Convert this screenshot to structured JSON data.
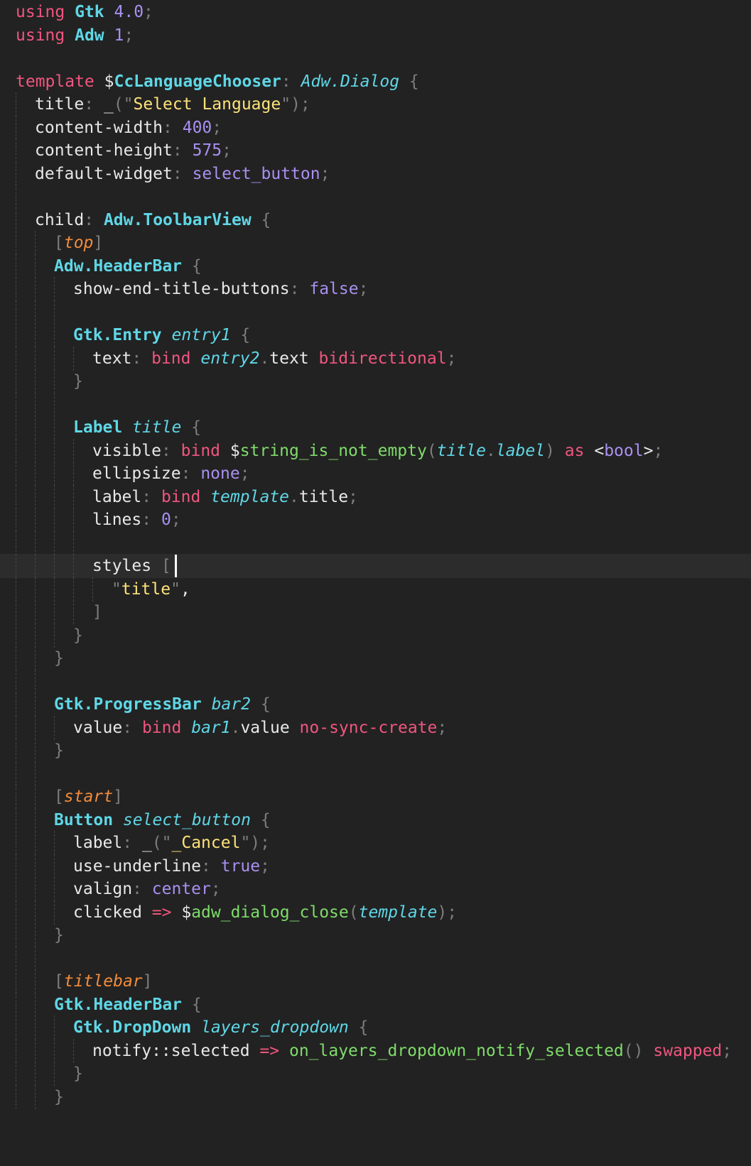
{
  "editor": {
    "language": "blueprint",
    "current_line": 24,
    "lines": [
      {
        "indent": 0,
        "tokens": [
          [
            "k",
            "using"
          ],
          [
            "w",
            " "
          ],
          [
            "ty",
            "Gtk"
          ],
          [
            "n",
            " 4.0"
          ],
          [
            "p",
            ";"
          ]
        ]
      },
      {
        "indent": 0,
        "tokens": [
          [
            "k",
            "using"
          ],
          [
            "w",
            " "
          ],
          [
            "ty",
            "Adw"
          ],
          [
            "n",
            " 1"
          ],
          [
            "p",
            ";"
          ]
        ]
      },
      {
        "indent": 0,
        "tokens": []
      },
      {
        "indent": 0,
        "tokens": [
          [
            "k",
            "template"
          ],
          [
            "w",
            " $"
          ],
          [
            "ty",
            "CcLanguageChooser"
          ],
          [
            "p",
            ": "
          ],
          [
            "it",
            "Adw.Dialog"
          ],
          [
            "p",
            " {"
          ]
        ]
      },
      {
        "indent": 1,
        "tokens": [
          [
            "w",
            "title"
          ],
          [
            "p",
            ": "
          ],
          [
            "w",
            "_"
          ],
          [
            "p",
            "(\""
          ],
          [
            "s",
            "Select Language"
          ],
          [
            "p",
            "\");"
          ]
        ]
      },
      {
        "indent": 1,
        "tokens": [
          [
            "w",
            "content-width"
          ],
          [
            "p",
            ": "
          ],
          [
            "n",
            "400"
          ],
          [
            "p",
            ";"
          ]
        ]
      },
      {
        "indent": 1,
        "tokens": [
          [
            "w",
            "content-height"
          ],
          [
            "p",
            ": "
          ],
          [
            "n",
            "575"
          ],
          [
            "p",
            ";"
          ]
        ]
      },
      {
        "indent": 1,
        "tokens": [
          [
            "w",
            "default-widget"
          ],
          [
            "p",
            ": "
          ],
          [
            "n",
            "select_button"
          ],
          [
            "p",
            ";"
          ]
        ]
      },
      {
        "indent": 1,
        "tokens": []
      },
      {
        "indent": 1,
        "tokens": [
          [
            "w",
            "child"
          ],
          [
            "p",
            ": "
          ],
          [
            "ty",
            "Adw.ToolbarView"
          ],
          [
            "p",
            " {"
          ]
        ]
      },
      {
        "indent": 2,
        "tokens": [
          [
            "p",
            "["
          ],
          [
            "ann",
            "top"
          ],
          [
            "p",
            "]"
          ]
        ]
      },
      {
        "indent": 2,
        "tokens": [
          [
            "ty",
            "Adw.HeaderBar"
          ],
          [
            "p",
            " {"
          ]
        ]
      },
      {
        "indent": 3,
        "tokens": [
          [
            "w",
            "show-end-title-buttons"
          ],
          [
            "p",
            ": "
          ],
          [
            "n",
            "false"
          ],
          [
            "p",
            ";"
          ]
        ]
      },
      {
        "indent": 3,
        "tokens": []
      },
      {
        "indent": 3,
        "tokens": [
          [
            "ty",
            "Gtk.Entry"
          ],
          [
            "w",
            " "
          ],
          [
            "it",
            "entry1"
          ],
          [
            "p",
            " {"
          ]
        ]
      },
      {
        "indent": 4,
        "tokens": [
          [
            "w",
            "text"
          ],
          [
            "p",
            ": "
          ],
          [
            "k",
            "bind"
          ],
          [
            "w",
            " "
          ],
          [
            "it",
            "entry2"
          ],
          [
            "p",
            "."
          ],
          [
            "w",
            "text "
          ],
          [
            "k",
            "bidirectional"
          ],
          [
            "p",
            ";"
          ]
        ]
      },
      {
        "indent": 3,
        "tokens": [
          [
            "p",
            "}"
          ]
        ]
      },
      {
        "indent": 3,
        "tokens": []
      },
      {
        "indent": 3,
        "tokens": [
          [
            "ty",
            "Label"
          ],
          [
            "w",
            " "
          ],
          [
            "it",
            "title"
          ],
          [
            "p",
            " {"
          ]
        ]
      },
      {
        "indent": 4,
        "tokens": [
          [
            "w",
            "visible"
          ],
          [
            "p",
            ": "
          ],
          [
            "k",
            "bind"
          ],
          [
            "w",
            " $"
          ],
          [
            "f",
            "string_is_not_empty"
          ],
          [
            "p",
            "("
          ],
          [
            "it",
            "title"
          ],
          [
            "p",
            "."
          ],
          [
            "it",
            "label"
          ],
          [
            "p",
            ")"
          ],
          [
            "w",
            " "
          ],
          [
            "k",
            "as"
          ],
          [
            "w",
            " <"
          ],
          [
            "n",
            "bool"
          ],
          [
            "w",
            ">"
          ],
          [
            "p",
            ";"
          ]
        ]
      },
      {
        "indent": 4,
        "tokens": [
          [
            "w",
            "ellipsize"
          ],
          [
            "p",
            ": "
          ],
          [
            "n",
            "none"
          ],
          [
            "p",
            ";"
          ]
        ]
      },
      {
        "indent": 4,
        "tokens": [
          [
            "w",
            "label"
          ],
          [
            "p",
            ": "
          ],
          [
            "k",
            "bind"
          ],
          [
            "w",
            " "
          ],
          [
            "it",
            "template"
          ],
          [
            "p",
            "."
          ],
          [
            "w",
            "title"
          ],
          [
            "p",
            ";"
          ]
        ]
      },
      {
        "indent": 4,
        "tokens": [
          [
            "w",
            "lines"
          ],
          [
            "p",
            ": "
          ],
          [
            "n",
            "0"
          ],
          [
            "p",
            ";"
          ]
        ]
      },
      {
        "indent": 4,
        "tokens": []
      },
      {
        "indent": 4,
        "tokens": [
          [
            "w",
            "styles "
          ],
          [
            "p",
            "["
          ]
        ]
      },
      {
        "indent": 5,
        "tokens": [
          [
            "p",
            "\""
          ],
          [
            "s",
            "title"
          ],
          [
            "p",
            "\""
          ],
          [
            "w",
            ","
          ]
        ]
      },
      {
        "indent": 4,
        "tokens": [
          [
            "p",
            "]"
          ]
        ]
      },
      {
        "indent": 3,
        "tokens": [
          [
            "p",
            "}"
          ]
        ]
      },
      {
        "indent": 2,
        "tokens": [
          [
            "p",
            "}"
          ]
        ]
      },
      {
        "indent": 2,
        "tokens": []
      },
      {
        "indent": 2,
        "tokens": [
          [
            "ty",
            "Gtk.ProgressBar"
          ],
          [
            "w",
            " "
          ],
          [
            "it",
            "bar2"
          ],
          [
            "p",
            " {"
          ]
        ]
      },
      {
        "indent": 3,
        "tokens": [
          [
            "w",
            "value"
          ],
          [
            "p",
            ": "
          ],
          [
            "k",
            "bind"
          ],
          [
            "w",
            " "
          ],
          [
            "it",
            "bar1"
          ],
          [
            "p",
            "."
          ],
          [
            "w",
            "value "
          ],
          [
            "k",
            "no-sync-create"
          ],
          [
            "p",
            ";"
          ]
        ]
      },
      {
        "indent": 2,
        "tokens": [
          [
            "p",
            "}"
          ]
        ]
      },
      {
        "indent": 2,
        "tokens": []
      },
      {
        "indent": 2,
        "tokens": [
          [
            "p",
            "["
          ],
          [
            "ann",
            "start"
          ],
          [
            "p",
            "]"
          ]
        ]
      },
      {
        "indent": 2,
        "tokens": [
          [
            "ty",
            "Button"
          ],
          [
            "w",
            " "
          ],
          [
            "it",
            "select_button"
          ],
          [
            "p",
            " {"
          ]
        ]
      },
      {
        "indent": 3,
        "tokens": [
          [
            "w",
            "label"
          ],
          [
            "p",
            ": "
          ],
          [
            "w",
            "_"
          ],
          [
            "p",
            "(\""
          ],
          [
            "s",
            "_Cancel"
          ],
          [
            "p",
            "\");"
          ]
        ]
      },
      {
        "indent": 3,
        "tokens": [
          [
            "w",
            "use-underline"
          ],
          [
            "p",
            ": "
          ],
          [
            "n",
            "true"
          ],
          [
            "p",
            ";"
          ]
        ]
      },
      {
        "indent": 3,
        "tokens": [
          [
            "w",
            "valign"
          ],
          [
            "p",
            ": "
          ],
          [
            "n",
            "center"
          ],
          [
            "p",
            ";"
          ]
        ]
      },
      {
        "indent": 3,
        "tokens": [
          [
            "w",
            "clicked "
          ],
          [
            "k",
            "=>"
          ],
          [
            "w",
            " $"
          ],
          [
            "f",
            "adw_dialog_close"
          ],
          [
            "p",
            "("
          ],
          [
            "it",
            "template"
          ],
          [
            "p",
            ");"
          ]
        ]
      },
      {
        "indent": 2,
        "tokens": [
          [
            "p",
            "}"
          ]
        ]
      },
      {
        "indent": 2,
        "tokens": []
      },
      {
        "indent": 2,
        "tokens": [
          [
            "p",
            "["
          ],
          [
            "ann",
            "titlebar"
          ],
          [
            "p",
            "]"
          ]
        ]
      },
      {
        "indent": 2,
        "tokens": [
          [
            "ty",
            "Gtk.HeaderBar"
          ],
          [
            "p",
            " {"
          ]
        ]
      },
      {
        "indent": 3,
        "tokens": [
          [
            "ty",
            "Gtk.DropDown"
          ],
          [
            "w",
            " "
          ],
          [
            "it",
            "layers_dropdown"
          ],
          [
            "p",
            " {"
          ]
        ]
      },
      {
        "indent": 4,
        "tokens": [
          [
            "w",
            "notify::selected "
          ],
          [
            "k",
            "=>"
          ],
          [
            "w",
            " "
          ],
          [
            "f",
            "on_layers_dropdown_notify_selected"
          ],
          [
            "p",
            "()"
          ],
          [
            "w",
            " "
          ],
          [
            "k",
            "swapped"
          ],
          [
            "p",
            ";"
          ]
        ]
      },
      {
        "indent": 3,
        "tokens": [
          [
            "p",
            "}"
          ]
        ]
      },
      {
        "indent": 2,
        "tokens": [
          [
            "p",
            "}"
          ]
        ]
      }
    ]
  }
}
